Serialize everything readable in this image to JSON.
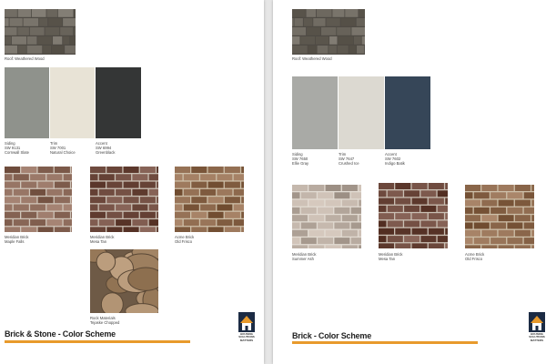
{
  "colors": {
    "accent_bar": "#e89a2c",
    "left_siding": "#8f928c",
    "left_trim": "#e8e3d6",
    "left_accent": "#343636",
    "right_siding": "#a9aaa6",
    "right_trim": "#dcd9d1",
    "right_accent": "#364658"
  },
  "left": {
    "roof_caption": "Roof: Weathered Wood",
    "swatches": [
      {
        "lines": [
          "Siding",
          "SW 9131",
          "Cornwall Slate"
        ]
      },
      {
        "lines": [
          "Trim",
          "SW 7001",
          "Natural Choice"
        ]
      },
      {
        "lines": [
          "Accent",
          "SW 6994",
          "Greenblack"
        ]
      }
    ],
    "bricks": [
      {
        "lines": [
          "Meridian Brick",
          "Maple Falls"
        ]
      },
      {
        "lines": [
          "Meridian Brick",
          "Mesa Tan"
        ]
      },
      {
        "lines": [
          "Acme Brick",
          "Old Frisco"
        ]
      }
    ],
    "stone": {
      "lines": [
        "Rock Materials",
        "Tejaske Chopped"
      ]
    },
    "title": "Brick & Stone - Color Scheme",
    "logo_lines": [
      "HOUSING",
      "SOLUTIONS",
      "MATTERS"
    ]
  },
  "right": {
    "roof_caption": "Roof: Weathered Wood",
    "swatches": [
      {
        "lines": [
          "Siding",
          "SW 7650",
          "Ellie Gray"
        ]
      },
      {
        "lines": [
          "Trim",
          "SW 7647",
          "Crushed Ice"
        ]
      },
      {
        "lines": [
          "Accent",
          "SW 7602",
          "Indigo Batik"
        ]
      }
    ],
    "bricks": [
      {
        "lines": [
          "Meridian Brick",
          "Summer Ash"
        ]
      },
      {
        "lines": [
          "Meridian Brick",
          "Mesa Tan"
        ]
      },
      {
        "lines": [
          "Acme Brick",
          "Old Frisco"
        ]
      }
    ],
    "title": "Brick - Color Scheme",
    "logo_lines": [
      "HOUSING",
      "SOLUTIONS",
      "MATTERS"
    ]
  }
}
